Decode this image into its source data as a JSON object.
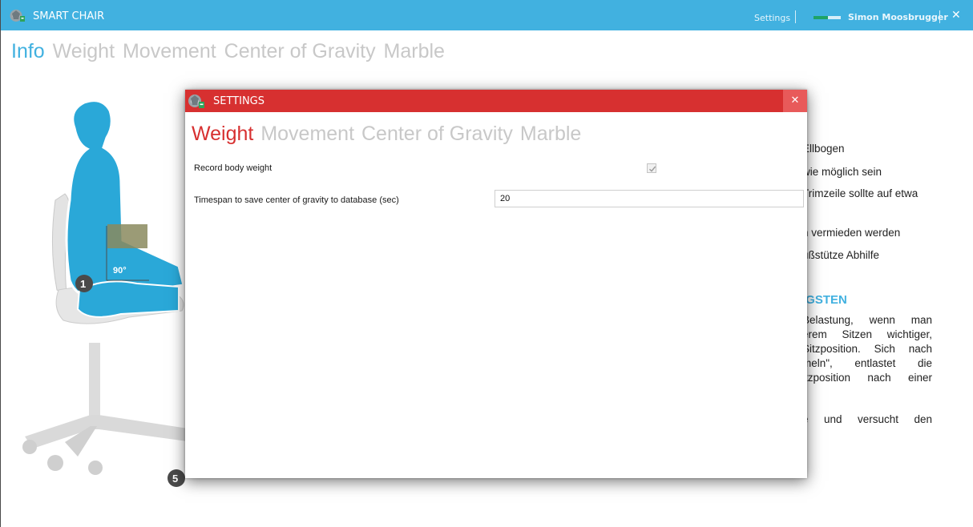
{
  "app": {
    "title": "SMART CHAIR",
    "settings_link": "Settings",
    "user": "Simon Moosbrugger",
    "close_glyph": "✕",
    "accent_color": "#41b1e0"
  },
  "main_tabs": [
    {
      "label": "Info",
      "active": true
    },
    {
      "label": "Weight",
      "active": false
    },
    {
      "label": "Movement",
      "active": false
    },
    {
      "label": "Center of Gravity",
      "active": false
    },
    {
      "label": "Marble",
      "active": false
    }
  ],
  "illustration": {
    "angle_label": "90°",
    "markers": [
      "1",
      "5"
    ]
  },
  "article": {
    "lines": [
      "Ellbogen",
      "wie möglich sein",
      "Trimzeile sollte auf etwa",
      "n vermieden werden",
      "ußstütze Abhilfe"
    ],
    "heading": "IGSTEN",
    "paragraph": [
      "Belastung, wenn man",
      "erem Sitzen wichtiger,",
      "Sitzposition. Sich nach",
      "meln\", entlastet die",
      "itzposition nach einer",
      "e und versucht den"
    ]
  },
  "settings_dialog": {
    "title": "SETTINGS",
    "close_glyph": "✕",
    "accent_color": "#d73030",
    "tabs": [
      {
        "label": "Weight",
        "active": true
      },
      {
        "label": "Movement",
        "active": false
      },
      {
        "label": "Center of Gravity",
        "active": false
      },
      {
        "label": "Marble",
        "active": false
      }
    ],
    "record_weight_label": "Record body weight",
    "record_weight_checked": true,
    "timespan_label": "Timespan to save center of gravity to database (sec)",
    "timespan_value": "20"
  }
}
